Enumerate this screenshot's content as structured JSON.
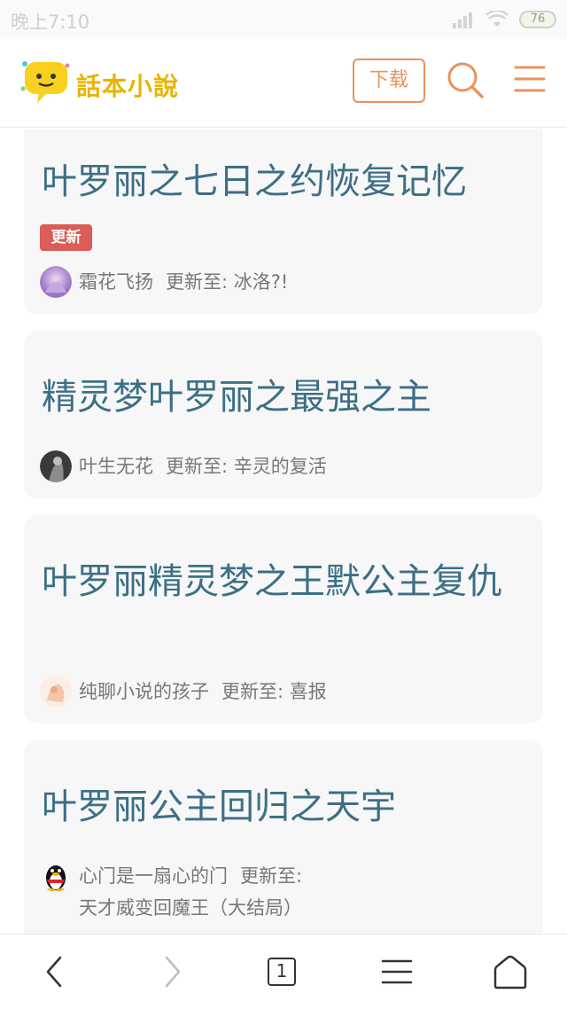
{
  "status_bar": {
    "time": "晚上7:10",
    "battery": "76"
  },
  "header": {
    "logo_text": "話本小說",
    "download_label": "下载"
  },
  "cards": [
    {
      "title": "叶罗丽之七日之约恢复记忆",
      "badge": "更新",
      "author": "霜花飞扬",
      "update_prefix": "更新至:",
      "latest_chapter": "冰洛?!"
    },
    {
      "title": "精灵梦叶罗丽之最强之主",
      "author": "叶生无花",
      "update_prefix": "更新至:",
      "latest_chapter": "辛灵的复活"
    },
    {
      "title": "叶罗丽精灵梦之王默公主复仇",
      "author": "纯聊小说的孩子",
      "update_prefix": "更新至:",
      "latest_chapter": "喜报"
    },
    {
      "title": "叶罗丽公主回归之天宇",
      "author": "心门是一扇心的门",
      "update_prefix": "更新至:",
      "latest_chapter": "天才威变回魔王（大结局）"
    }
  ],
  "bottom_bar": {
    "tab_count": "1"
  },
  "colors": {
    "accent": "#e8935e",
    "title": "#3c6f86",
    "badge": "#dc5c57"
  }
}
